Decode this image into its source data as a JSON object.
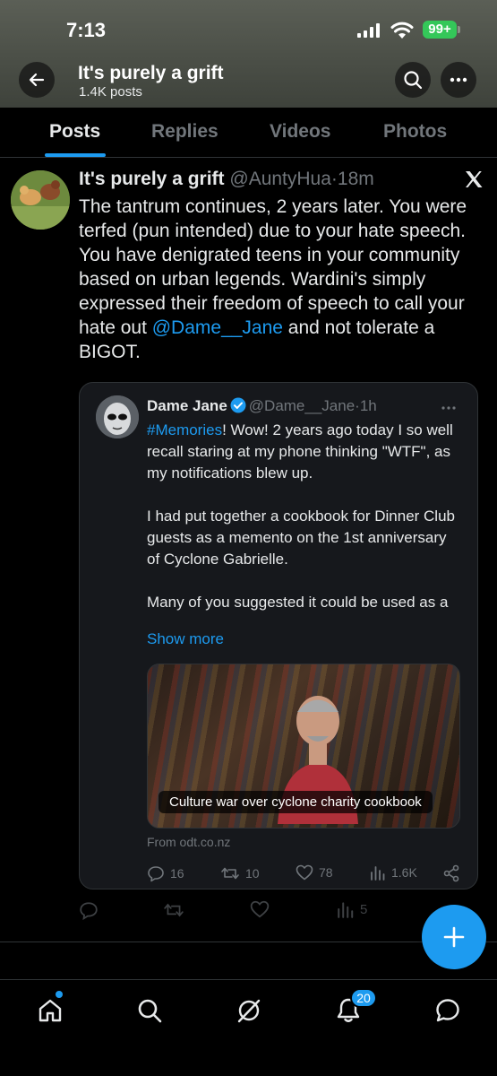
{
  "status_bar": {
    "time": "7:13",
    "battery": "99+"
  },
  "header": {
    "title": "It's purely a grift",
    "subtitle": "1.4K posts"
  },
  "tabs": [
    {
      "label": "Posts",
      "active": true
    },
    {
      "label": "Replies",
      "active": false
    },
    {
      "label": "Videos",
      "active": false
    },
    {
      "label": "Photos",
      "active": false
    }
  ],
  "post": {
    "author_name": "It's purely a grift",
    "handle": "@AuntyHua",
    "separator": "·",
    "time": "18m",
    "text_before_mention": "The tantrum continues, 2 years later. You were terfed (pun intended) due to your hate speech. You have denigrated teens in your community based on urban legends. Wardini's  simply expressed their freedom of speech to call your hate out ",
    "mention": "@Dame__Jane",
    "text_after_mention": " and not tolerate a BIGOT.",
    "actions": {
      "views": "5"
    }
  },
  "quote": {
    "author_name": "Dame Jane",
    "handle": "@Dame__Jane",
    "separator": "·",
    "time": "1h",
    "hashtag": "#Memories",
    "para1_rest": "! Wow! 2 years ago today I so well recall staring at my phone thinking \"WTF\", as my notifications blew up.",
    "para2": "I had put together a cookbook for Dinner Club guests as a memento on the 1st anniversary of Cyclone Gabrielle.",
    "para3": "Many of you suggested it could be used as a",
    "show_more": "Show more",
    "card_caption": "Culture war over cyclone charity cookbook",
    "card_source": "From odt.co.nz",
    "actions": {
      "replies": "16",
      "reposts": "10",
      "likes": "78",
      "views": "1.6K"
    }
  },
  "bottom_nav": {
    "notifications_badge": "20"
  },
  "colors": {
    "accent": "#1d9bf0",
    "background": "#000000",
    "muted": "#71767b",
    "text": "#e7e9ea"
  }
}
